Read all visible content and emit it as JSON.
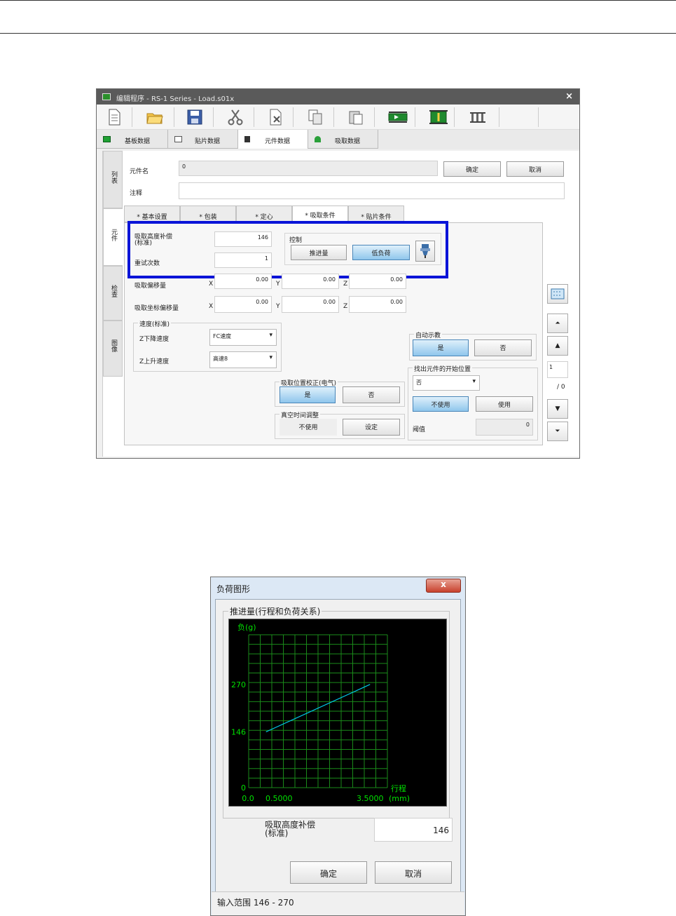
{
  "window": {
    "title": "编辑程序 - RS-1 Series - Load.s01x",
    "close": "×"
  },
  "top_tabs": [
    {
      "label": "基板数据"
    },
    {
      "label": "贴片数据"
    },
    {
      "label": "元件数据"
    },
    {
      "label": "吸取数据"
    }
  ],
  "side_tabs": [
    "列表",
    "元件",
    "检查",
    "图像"
  ],
  "form": {
    "part_name_label": "元件名",
    "part_name_value": "0",
    "confirm": "确定",
    "cancel": "取消",
    "comment_label": "注释",
    "comment_value": ""
  },
  "sub_tabs": [
    "* 基本设置",
    "* 包装",
    "* 定心",
    "* 吸取条件",
    "* 贴片条件"
  ],
  "pick": {
    "height_comp_label": "吸取高度补偿\n(标准)",
    "height_comp_value": "146",
    "retry_label": "重试次数",
    "retry_value": "1",
    "control_label": "控制",
    "push_btn": "推进量",
    "low_load_btn": "低负荷",
    "offset_label": "吸取偏移量",
    "offset": {
      "x_label": "X",
      "x": "0.00",
      "y_label": "Y",
      "y": "0.00",
      "z_label": "Z",
      "z": "0.00"
    },
    "coord_offset_label": "吸取坐标偏移量",
    "coord_offset": {
      "x_label": "X",
      "x": "0.00",
      "y_label": "Y",
      "y": "0.00",
      "z_label": "Z",
      "z": "0.00"
    }
  },
  "speed": {
    "group_label": "速度(标准)",
    "z_down_label": "Z下降速度",
    "z_down_value": "FC速度",
    "z_up_label": "Z上升速度",
    "z_up_value": "高速8"
  },
  "auto_teach": {
    "label": "自动示教",
    "yes": "是",
    "no": "否"
  },
  "pick_pos_correct": {
    "label": "吸取位置校正(电气)",
    "yes": "是",
    "no": "否"
  },
  "vacuum": {
    "label": "真空时间调整",
    "not_use": "不使用",
    "set": "设定"
  },
  "detect": {
    "label": "找出元件的开始位置",
    "select_value": "否",
    "not_use": "不使用",
    "use": "使用",
    "threshold_label": "阈值",
    "threshold_value": "0"
  },
  "pager": {
    "current": "1",
    "total": "/ 0"
  },
  "dialog": {
    "title": "负荷图形",
    "close": "x",
    "group_label": "推进量(行程和负荷关系)",
    "param_label": "吸取高度补偿\n(标准)",
    "param_value": "146",
    "ok": "确定",
    "cancel": "取消",
    "status": "输入范围 146 - 270"
  },
  "chart_data": {
    "type": "line",
    "ylabel": "负(g)",
    "xlabel": "行程\n(mm)",
    "x_ticks": [
      "0.0",
      "0.5000",
      "3.5000"
    ],
    "y_ticks": [
      "0",
      "146",
      "270"
    ],
    "series": [
      {
        "x": [
          0.5,
          3.5
        ],
        "y": [
          146,
          270
        ]
      }
    ],
    "grid": true,
    "colors": {
      "grid": "#1a8a1a",
      "line": "#00c8e6",
      "text": "#00e000",
      "background": "#000000"
    }
  }
}
